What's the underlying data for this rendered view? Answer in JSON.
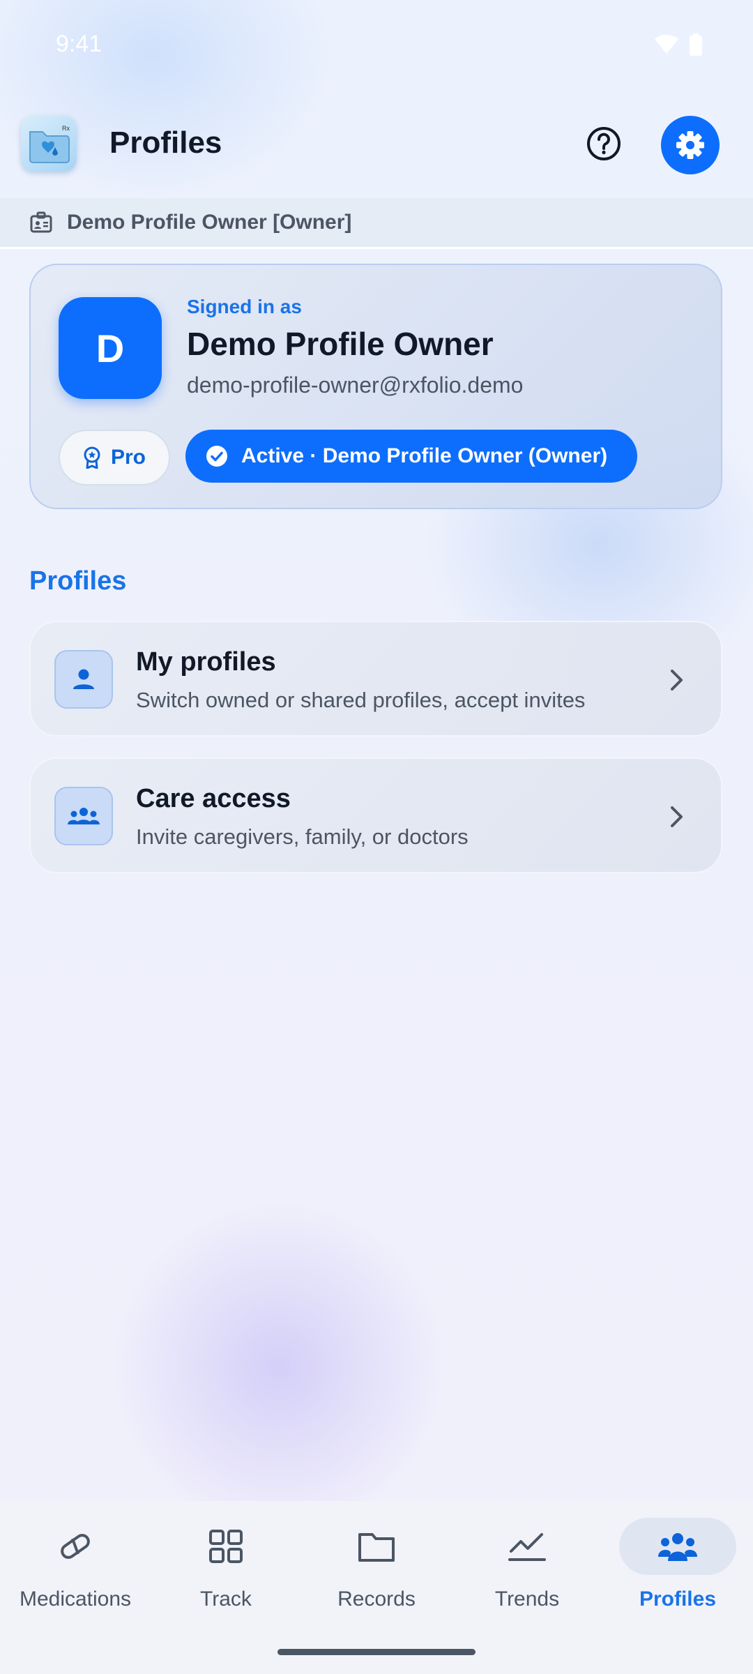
{
  "status_bar": {
    "time": "9:41"
  },
  "app_bar": {
    "title": "Profiles"
  },
  "profile_strip": {
    "text": "Demo Profile Owner [Owner]"
  },
  "account": {
    "signed_in_label": "Signed in as",
    "avatar_initial": "D",
    "name": "Demo Profile Owner",
    "email": "demo-profile-owner@rxfolio.demo",
    "plan_label": "Pro",
    "active_label": "Active · Demo Profile Owner (Owner)"
  },
  "section": {
    "title": "Profiles",
    "items": [
      {
        "title": "My profiles",
        "subtitle": "Switch owned or shared profiles, accept invites",
        "icon": "person-icon"
      },
      {
        "title": "Care access",
        "subtitle": "Invite caregivers, family, or doctors",
        "icon": "group-icon"
      }
    ]
  },
  "bottom_nav": {
    "items": [
      {
        "label": "Medications",
        "icon": "pill-icon"
      },
      {
        "label": "Track",
        "icon": "grid-icon"
      },
      {
        "label": "Records",
        "icon": "folder-icon"
      },
      {
        "label": "Trends",
        "icon": "trend-icon"
      },
      {
        "label": "Profiles",
        "icon": "people-icon",
        "active": true
      }
    ]
  },
  "colors": {
    "accent": "#0d6efd",
    "accent_text": "#1a73e8",
    "text_primary": "#111827",
    "text_secondary": "#4b5563"
  }
}
